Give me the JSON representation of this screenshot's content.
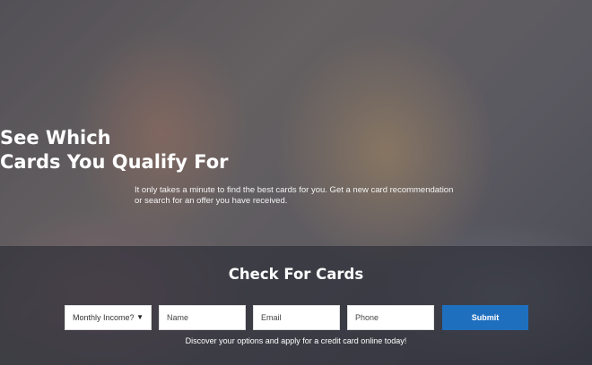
{
  "hero": {
    "title_line1": "See Which",
    "title_line2": "Cards You Qualify For",
    "subtitle_line1": "It only takes a minute to find the best cards for you. Get a new card recommendation",
    "subtitle_line2": "or search for an offer you have received."
  },
  "form": {
    "heading": "Check For Cards",
    "income_select": "Monthly Income?",
    "name_placeholder": "Name",
    "email_placeholder": "Email",
    "phone_placeholder": "Phone",
    "submit_label": "Submit",
    "footnote": "Discover your options and apply for a credit card online today!"
  },
  "icons": {
    "income_dropdown": "caret-down-icon"
  },
  "colors": {
    "submit_button": "#1f6fbf",
    "overlay": "#2a2c36"
  }
}
